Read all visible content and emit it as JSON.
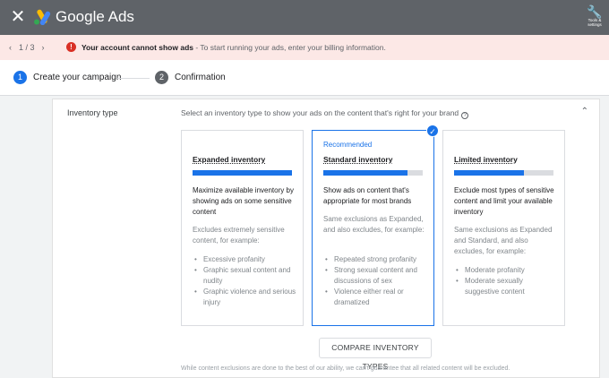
{
  "app": {
    "brand": "Google Ads",
    "tools_label": "Tools & settings"
  },
  "alert": {
    "pager": "1 / 3",
    "title": "Your account cannot show ads",
    "message": " - To start running your ads, enter your billing information."
  },
  "steps": [
    {
      "num": "1",
      "label": "Create your campaign",
      "active": true
    },
    {
      "num": "2",
      "label": "Confirmation",
      "active": false
    }
  ],
  "inventory": {
    "label": "Inventory type",
    "description": "Select an inventory type to show your ads on the content that's right for your brand",
    "compare_button": "COMPARE INVENTORY TYPES",
    "footnote": "While content exclusions are done to the best of our ability, we can't guarantee that all related content will be excluded."
  },
  "cards": [
    {
      "recommended": "",
      "title": "Expanded inventory",
      "level": 1.0,
      "description": "Maximize available inventory by showing ads on some sensitive content",
      "exclusions": "Excludes extremely sensitive content, for example:",
      "items": [
        "Excessive profanity",
        "Graphic sexual content and nudity",
        "Graphic violence and serious injury"
      ]
    },
    {
      "recommended": "Recommended",
      "title": "Standard inventory",
      "level": 0.85,
      "description": "Show ads on content that's appropriate for most brands",
      "exclusions": "Same exclusions as Expanded, and also excludes, for example:",
      "items": [
        "Repeated strong profanity",
        "Strong sexual content and discussions of sex",
        "Violence either real or dramatized"
      ]
    },
    {
      "recommended": "",
      "title": "Limited inventory",
      "level": 0.7,
      "description": "Exclude most types of sensitive content and limit your available inventory",
      "exclusions": "Same exclusions as Expanded and Standard, and also excludes, for example:",
      "items": [
        "Moderate profanity",
        "Moderate sexually suggestive content"
      ]
    }
  ],
  "colors": {
    "accent": "#1a73e8",
    "topbar": "#5f6368",
    "alert_bg": "#fce8e6",
    "error": "#d93025"
  }
}
